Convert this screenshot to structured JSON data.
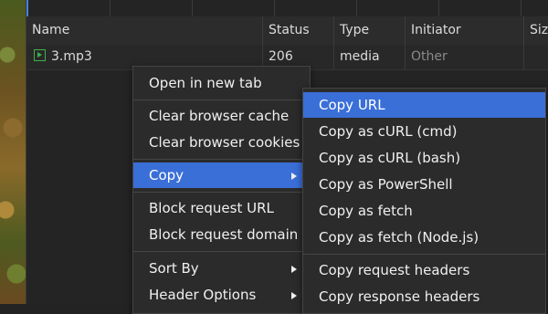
{
  "table": {
    "headers": [
      "Name",
      "Status",
      "Type",
      "Initiator",
      "Size"
    ],
    "row": {
      "name": "3.mp3",
      "status": "206",
      "type": "media",
      "initiator": "Other"
    }
  },
  "context_menu": {
    "items": [
      "Open in new tab",
      "Clear browser cache",
      "Clear browser cookies",
      "Copy",
      "Block request URL",
      "Block request domain",
      "Sort By",
      "Header Options"
    ]
  },
  "copy_submenu": {
    "items": [
      "Copy URL",
      "Copy as cURL (cmd)",
      "Copy as cURL (bash)",
      "Copy as PowerShell",
      "Copy as fetch",
      "Copy as fetch (Node.js)",
      "Copy request headers",
      "Copy response headers"
    ]
  },
  "colors": {
    "highlight": "#3a6fd8",
    "media_icon": "#3fb04a"
  }
}
